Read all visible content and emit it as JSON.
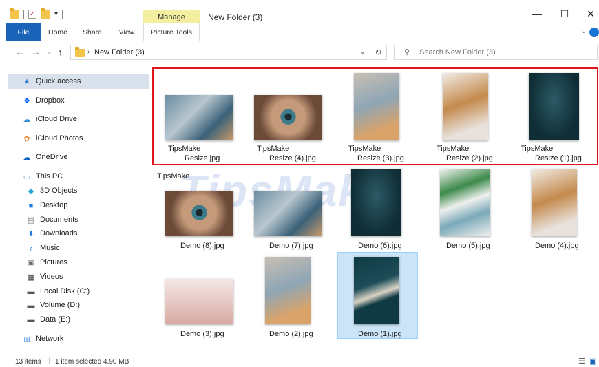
{
  "window": {
    "title": "New Folder (3)",
    "context_tab": "Manage"
  },
  "controls": {
    "minimize": "—",
    "maximize": "☐",
    "close": "✕"
  },
  "ribbon": {
    "tabs": [
      "File",
      "Home",
      "Share",
      "View",
      "Picture Tools"
    ]
  },
  "address": {
    "path": "New Folder (3)",
    "search_placeholder": "Search New Folder (3)"
  },
  "sidebar": {
    "items": [
      {
        "label": "Quick access",
        "icon": "star-icon",
        "selected": true
      },
      {
        "label": "Dropbox",
        "icon": "dropbox-icon"
      },
      {
        "label": "iCloud Drive",
        "icon": "cloud-icon"
      },
      {
        "label": "iCloud Photos",
        "icon": "photos-icon"
      },
      {
        "label": "OneDrive",
        "icon": "onedrive-icon"
      },
      {
        "label": "This PC",
        "icon": "pc-icon"
      },
      {
        "label": "3D Objects",
        "icon": "cube-icon"
      },
      {
        "label": "Desktop",
        "icon": "desktop-icon"
      },
      {
        "label": "Documents",
        "icon": "document-icon"
      },
      {
        "label": "Downloads",
        "icon": "download-icon"
      },
      {
        "label": "Music",
        "icon": "music-icon"
      },
      {
        "label": "Pictures",
        "icon": "pictures-icon"
      },
      {
        "label": "Videos",
        "icon": "video-icon"
      },
      {
        "label": "Local Disk (C:)",
        "icon": "disk-icon"
      },
      {
        "label": "Volume (D:)",
        "icon": "drive-icon"
      },
      {
        "label": "Data (E:)",
        "icon": "drive-icon"
      },
      {
        "label": "Network",
        "icon": "network-icon"
      }
    ]
  },
  "highlighted_files": [
    {
      "line1": "TipsMake",
      "line2": "Resize.jpg"
    },
    {
      "line1": "TipsMake",
      "line2": "Resize (4).jpg"
    },
    {
      "line1": "TipsMake",
      "line2": "Resize (3).jpg"
    },
    {
      "line1": "TipsMake",
      "line2": "Resize (2).jpg"
    },
    {
      "line1": "TipsMake",
      "line2": "Resize (1).jpg"
    }
  ],
  "group_label": "TipsMake",
  "files": [
    "Demo (8).jpg",
    "Demo (7).jpg",
    "Demo (6).jpg",
    "Demo (5).jpg",
    "Demo (4).jpg",
    "Demo (3).jpg",
    "Demo (2).jpg",
    "Demo (1).jpg"
  ],
  "status": {
    "count": "13 items",
    "selected": "1 item selected  4.90 MB"
  },
  "colors": {
    "accent": "#1a63b8",
    "selection": "#cce4f7",
    "highlight_border": "#e0141c"
  }
}
